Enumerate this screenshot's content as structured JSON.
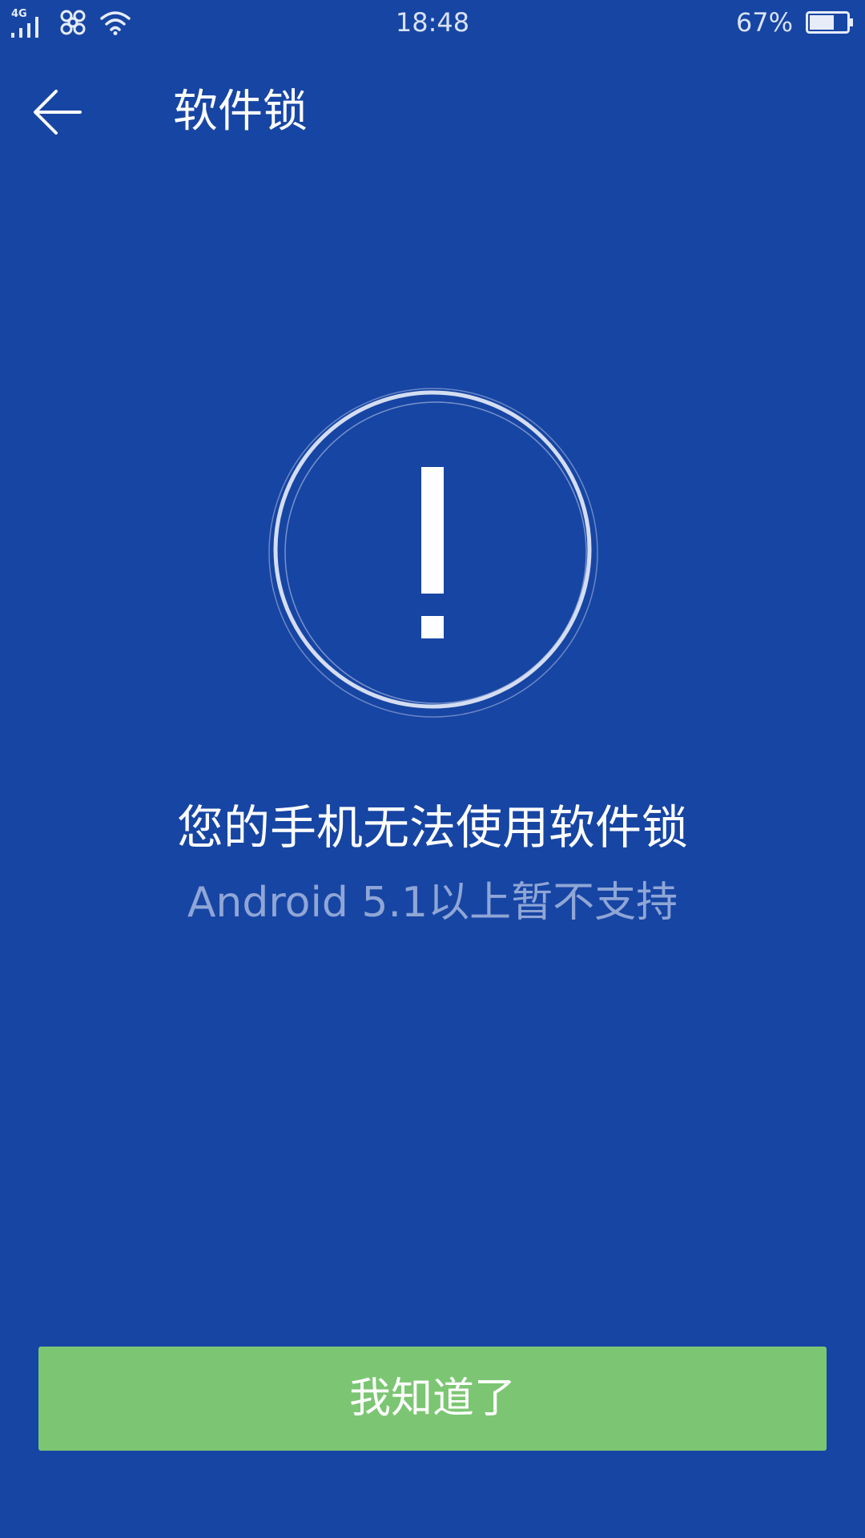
{
  "status_bar": {
    "network_type": "4G",
    "time": "18:48",
    "battery_percent": "67%",
    "battery_level": 0.67,
    "icons": [
      "signal-icon",
      "carrier-logo-icon",
      "wifi-icon",
      "battery-icon"
    ]
  },
  "header": {
    "back_icon": "back-arrow-icon",
    "title": "软件锁"
  },
  "warning": {
    "icon": "exclamation-icon"
  },
  "message": {
    "main": "您的手机无法使用软件锁",
    "sub": "Android 5.1以上暂不支持"
  },
  "button": {
    "label": "我知道了",
    "color": "#7cc673"
  },
  "colors": {
    "background": "#1745a3",
    "subtext": "#8fa6d6"
  }
}
